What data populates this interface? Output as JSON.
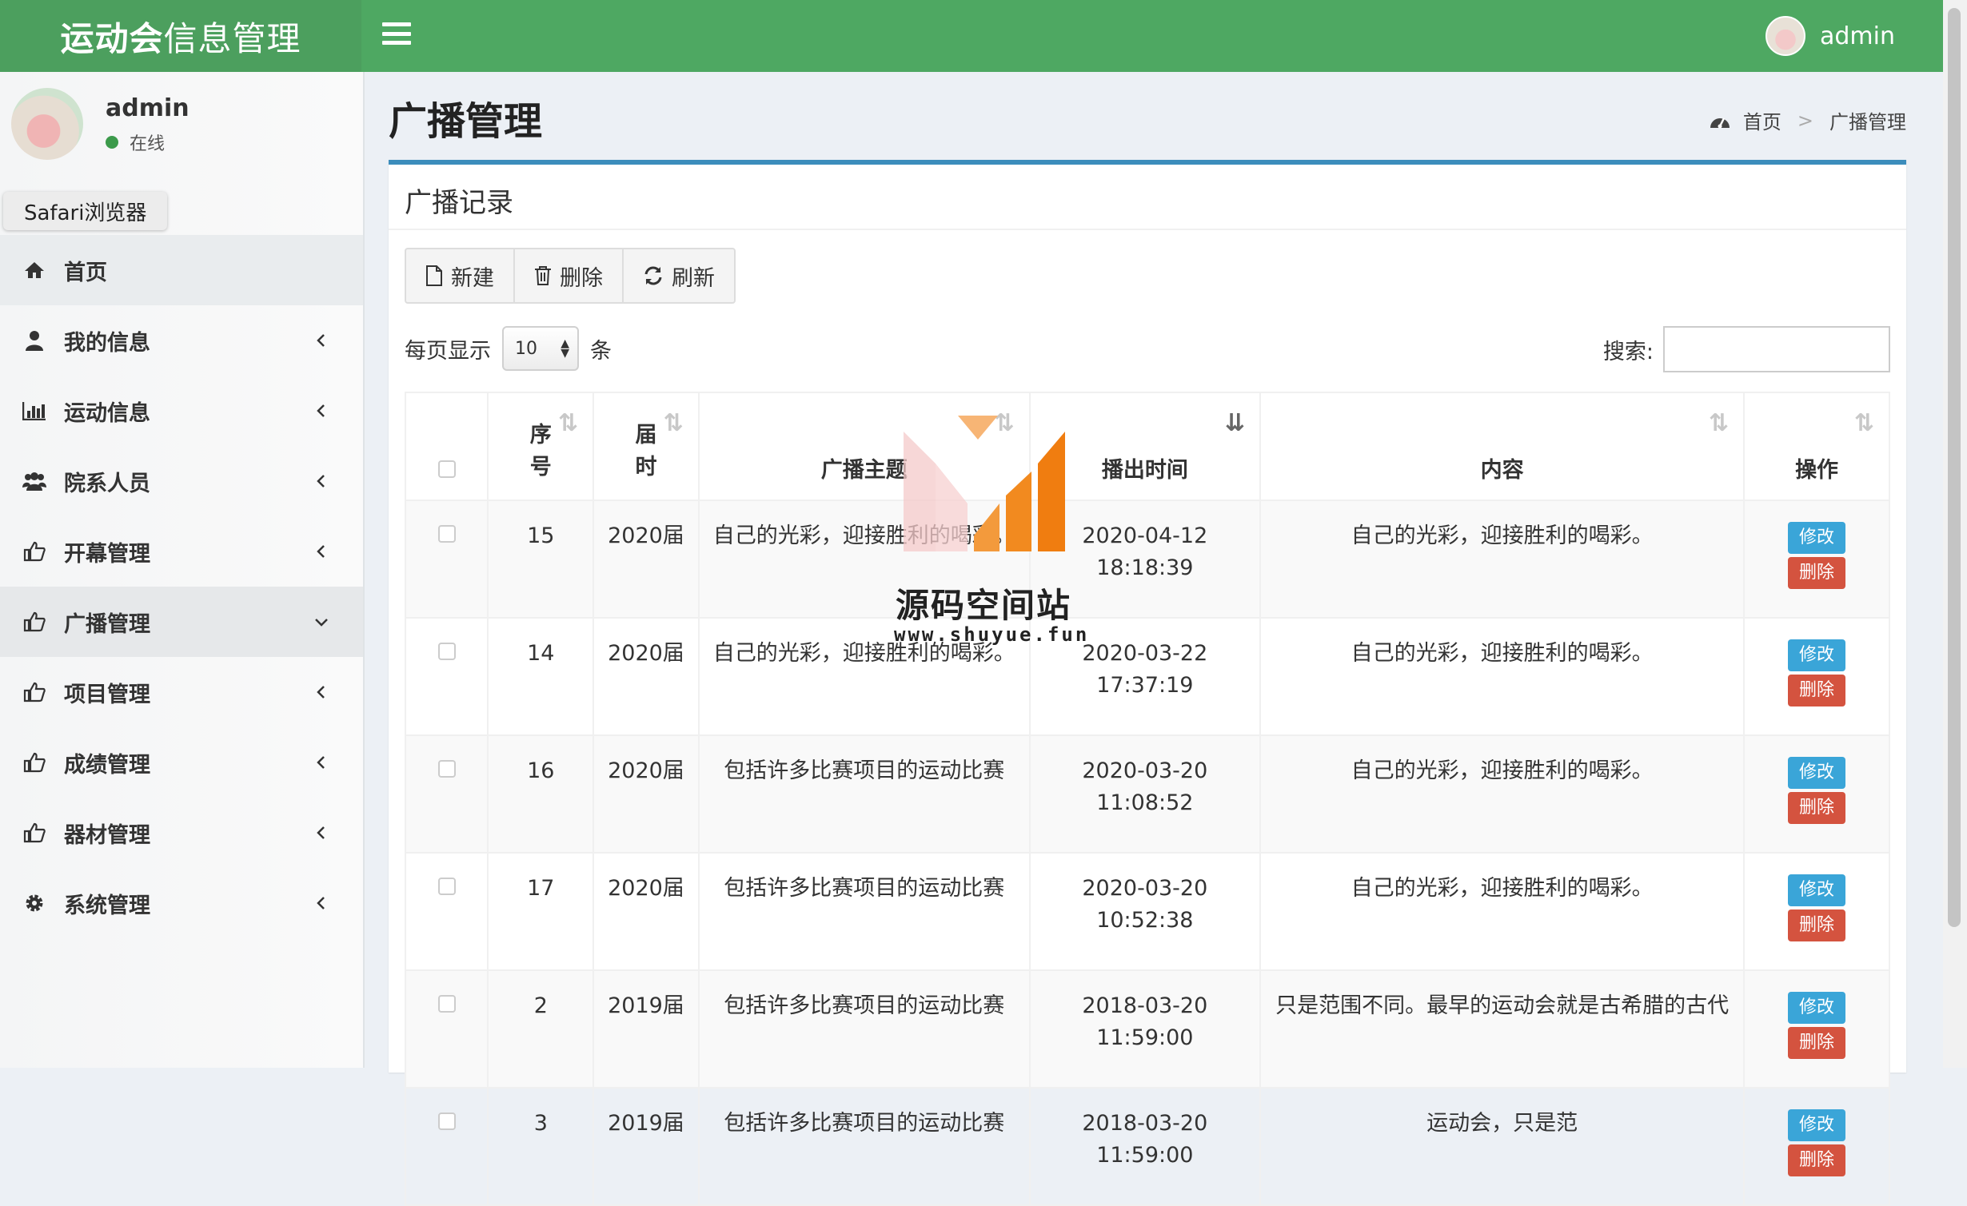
{
  "header": {
    "brand_bold": "运动会",
    "brand_rest": "信息管理",
    "user": "admin"
  },
  "sidebar": {
    "user_name": "admin",
    "status": "在线",
    "tooltip": "Safari浏览器",
    "items": [
      {
        "label": "首页",
        "icon": "home-icon"
      },
      {
        "label": "我的信息",
        "icon": "user-icon"
      },
      {
        "label": "运动信息",
        "icon": "bar-chart-icon"
      },
      {
        "label": "院系人员",
        "icon": "users-icon"
      },
      {
        "label": "开幕管理",
        "icon": "thumbs-up-icon"
      },
      {
        "label": "广播管理",
        "icon": "thumbs-up-icon"
      },
      {
        "label": "项目管理",
        "icon": "thumbs-up-icon"
      },
      {
        "label": "成绩管理",
        "icon": "thumbs-up-icon"
      },
      {
        "label": "器材管理",
        "icon": "thumbs-up-icon"
      },
      {
        "label": "系统管理",
        "icon": "gear-icon"
      }
    ]
  },
  "page": {
    "title": "广播管理",
    "breadcrumb_home": "首页",
    "breadcrumb_sep": ">",
    "breadcrumb_current": "广播管理"
  },
  "box": {
    "title": "广播记录",
    "btn_new": "新建",
    "btn_delete": "删除",
    "btn_refresh": "刷新",
    "per_page_prefix": "每页显示",
    "per_page_value": "10",
    "per_page_suffix": "条",
    "search_label": "搜索:"
  },
  "table": {
    "headers": {
      "seq": "序号",
      "session": "届时",
      "topic": "广播主题",
      "time": "播出时间",
      "content": "内容",
      "action": "操作"
    },
    "edit_label": "修改",
    "delete_label": "删除",
    "rows": [
      {
        "seq": "15",
        "session": "2020届",
        "topic": "自己的光彩，迎接胜利的喝彩。",
        "date": "2020-04-12",
        "time": "18:18:39",
        "content": "自己的光彩，迎接胜利的喝彩。"
      },
      {
        "seq": "14",
        "session": "2020届",
        "topic": "自己的光彩，迎接胜利的喝彩。",
        "date": "2020-03-22",
        "time": "17:37:19",
        "content": "自己的光彩，迎接胜利的喝彩。"
      },
      {
        "seq": "16",
        "session": "2020届",
        "topic": "包括许多比赛项目的运动比赛",
        "date": "2020-03-20",
        "time": "11:08:52",
        "content": "自己的光彩，迎接胜利的喝彩。"
      },
      {
        "seq": "17",
        "session": "2020届",
        "topic": "包括许多比赛项目的运动比赛",
        "date": "2020-03-20",
        "time": "10:52:38",
        "content": "自己的光彩，迎接胜利的喝彩。"
      },
      {
        "seq": "2",
        "session": "2019届",
        "topic": "包括许多比赛项目的运动比赛",
        "date": "2018-03-20",
        "time": "11:59:00",
        "content": "只是范围不同。最早的运动会就是古希腊的古代"
      },
      {
        "seq": "3",
        "session": "2019届",
        "topic": "包括许多比赛项目的运动比赛",
        "date": "2018-03-20",
        "time": "11:59:00",
        "content": "运动会，只是范"
      }
    ]
  },
  "watermark": {
    "name": "源码空间站",
    "url": "www.shuyue.fun"
  },
  "colors": {
    "header": "#4ea862",
    "box_top": "#3c8dbc",
    "edit": "#3aa5d8",
    "delete": "#d4533f",
    "status_online": "#3c9a4b"
  }
}
